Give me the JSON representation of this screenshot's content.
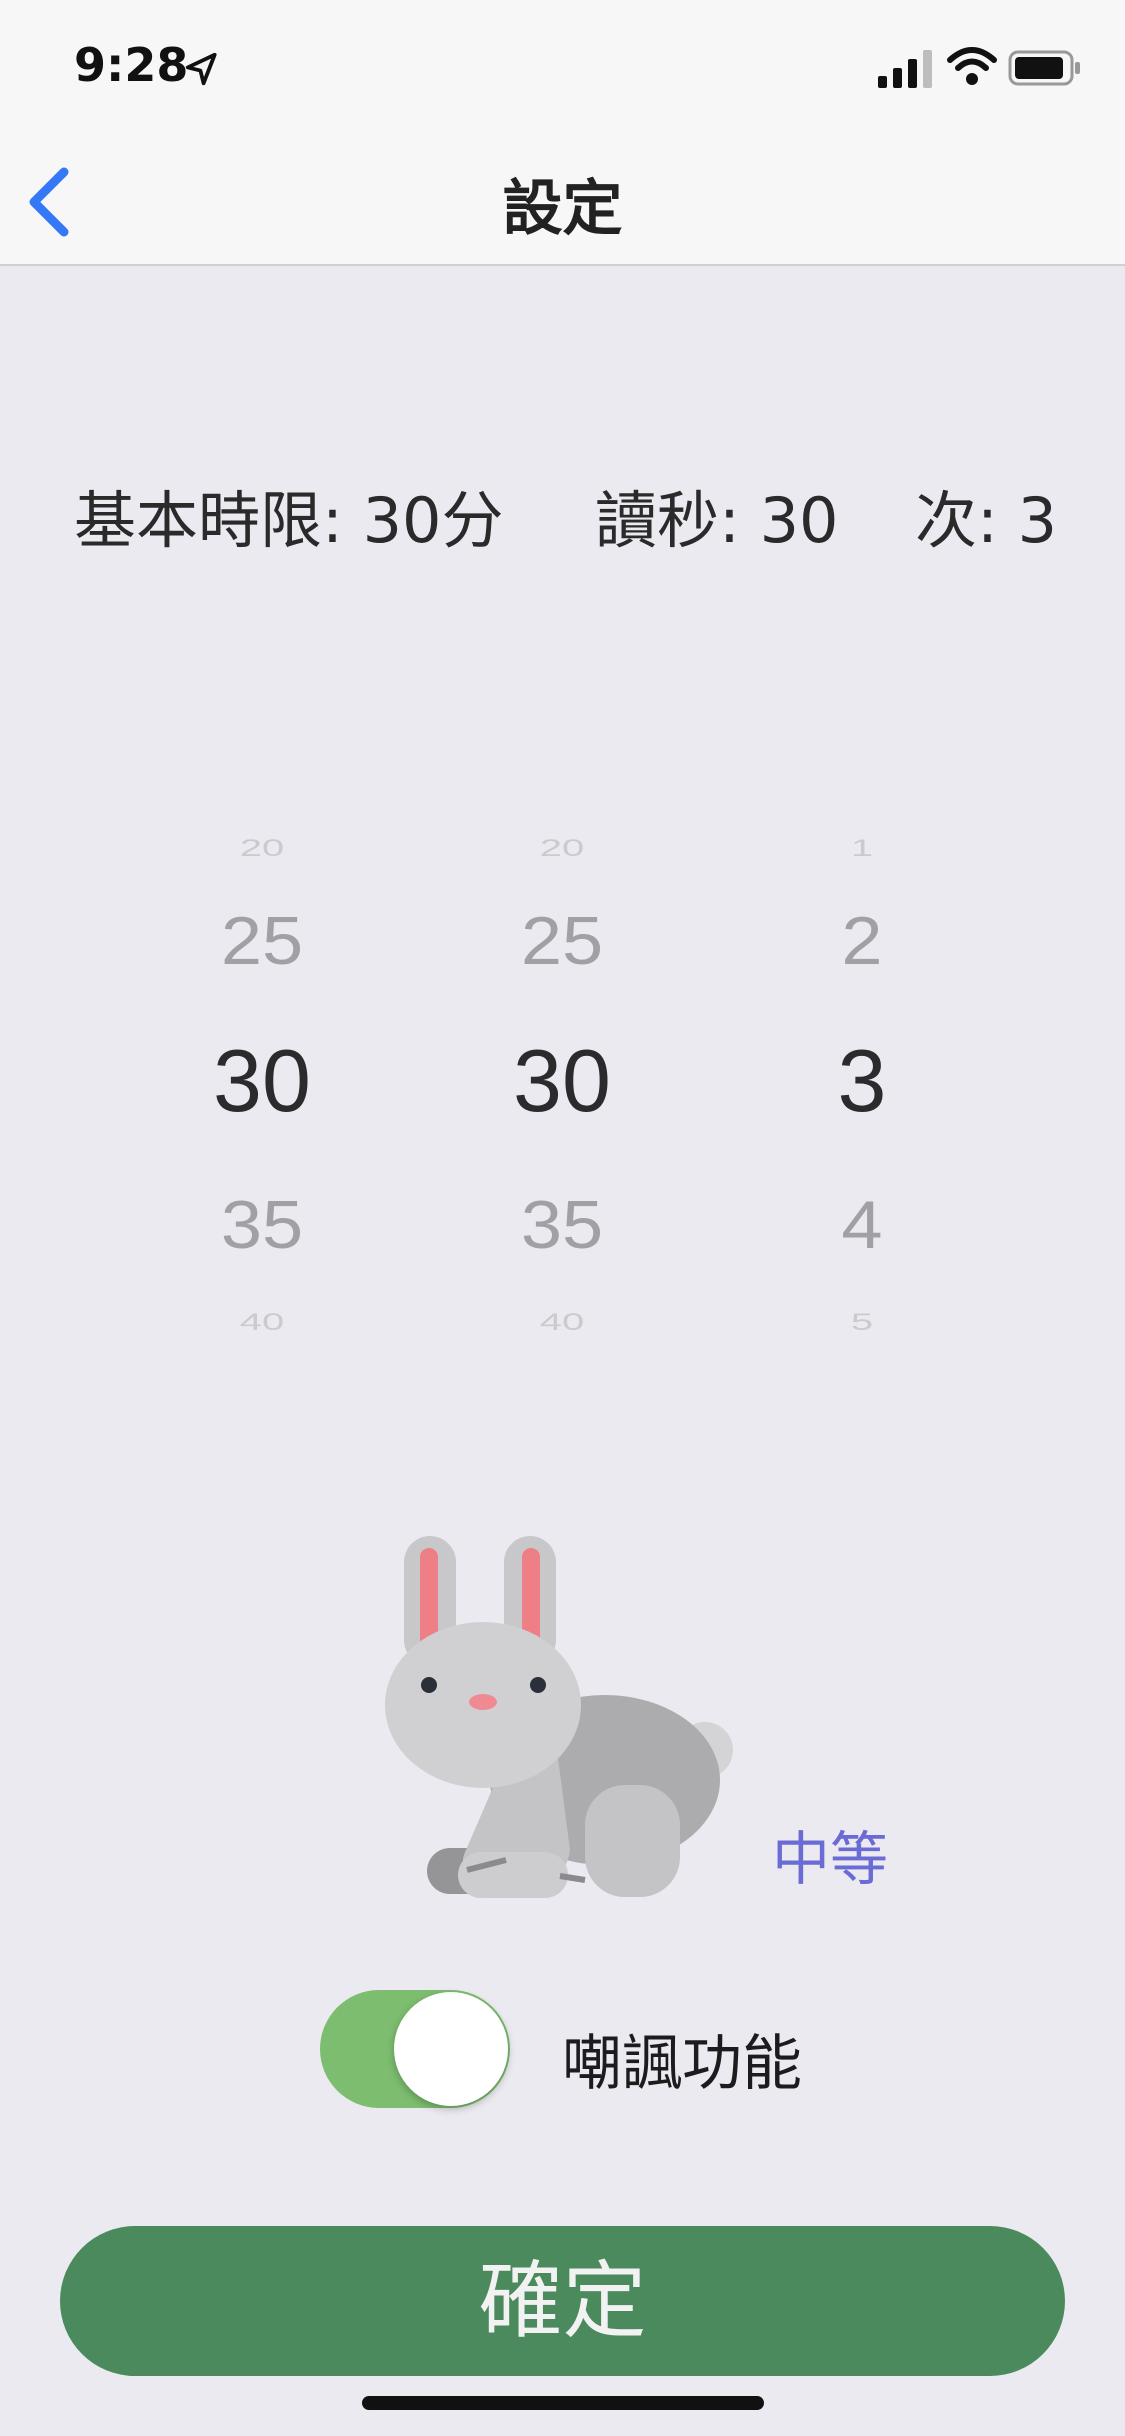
{
  "status_bar": {
    "time": "9:28"
  },
  "nav": {
    "title": "設定"
  },
  "summary": {
    "base_time": "基本時限: 30分",
    "byoyomi": "讀秒: 30",
    "times": "次: 3"
  },
  "pickers": {
    "base_time": [
      "20",
      "25",
      "30",
      "35",
      "40"
    ],
    "byoyomi": [
      "20",
      "25",
      "30",
      "35",
      "40"
    ],
    "times": [
      "1",
      "2",
      "3",
      "4",
      "5"
    ]
  },
  "level": {
    "label": "中等"
  },
  "sarcasm": {
    "label": "嘲諷功能",
    "enabled": true
  },
  "confirm": {
    "label": "確定"
  },
  "colors": {
    "accent": "#3478f6",
    "toggle_on": "#7dbd6f",
    "confirm_bg": "#4a8a5c",
    "level_text": "#6b6bd6"
  }
}
